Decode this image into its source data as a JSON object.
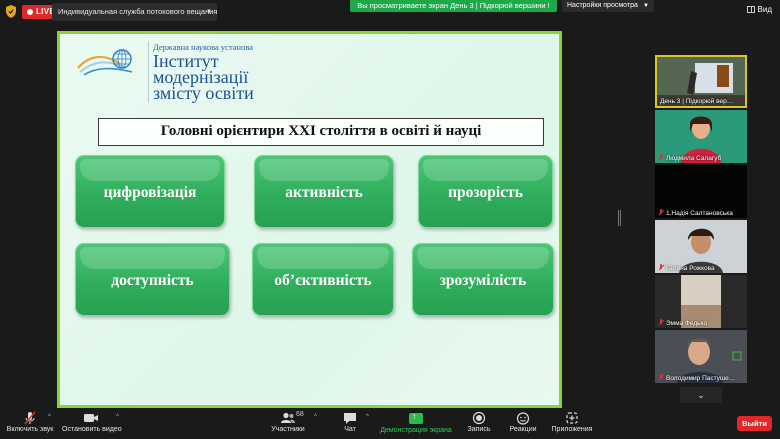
{
  "top_bar": {
    "live_label": "LIVE",
    "stream_service": "Индивидуальная служба потокового вещания",
    "share_banner": "Вы просматриваете экран День 3 | Підкорюй вершини !",
    "view_options": "Настройки просмотра",
    "view_button": "Вид"
  },
  "slide": {
    "institution_subtitle": "Державна наукова установа",
    "institution_name": "Інститут\nмодернізації\nзмісту освіти",
    "title": "Головні орієнтири ХХІ століття в освіті й науці",
    "tiles": [
      "цифровізація",
      "активність",
      "прозорість",
      "доступність",
      "об’єктивність",
      "зрозумілість"
    ]
  },
  "participants": [
    {
      "name": "День 3 | Підкорюй вер…",
      "muted": false,
      "active": true
    },
    {
      "name": "Людмила Салагуб",
      "muted": true
    },
    {
      "name": "1.Надія Салтановська",
      "muted": true
    },
    {
      "name": "Галина Рожкова",
      "muted": true
    },
    {
      "name": "Эмма Федько",
      "muted": true
    },
    {
      "name": "Володимир Пастуше…",
      "muted": true
    }
  ],
  "toolbar": {
    "unmute": "Включить звук",
    "stop_video": "Остановить видео",
    "participants": "Участники",
    "participants_count": "68",
    "chat": "Чат",
    "share_screen": "Демонстрация экрана",
    "record": "Запись",
    "reactions": "Реакции",
    "apps": "Приложения",
    "leave": "Выйти"
  },
  "colors": {
    "live": "#e02828",
    "share_banner": "#1ea84a",
    "slide_border": "#8bd33a",
    "tile": "#2fae5c",
    "share_label": "#2fce5a",
    "active_thumb": "#d8c81e"
  }
}
